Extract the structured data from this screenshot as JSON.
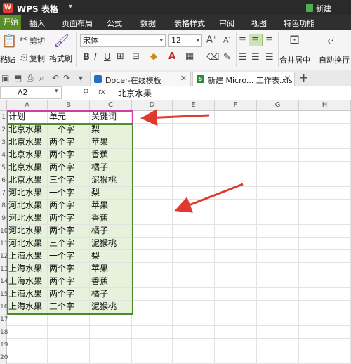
{
  "app": {
    "logo": "W",
    "title": "WPS 表格",
    "doc_title": "新建"
  },
  "menu": [
    "开始",
    "插入",
    "页面布局",
    "公式",
    "数据",
    "表格样式",
    "审阅",
    "视图",
    "特色功能"
  ],
  "ribbon": {
    "paste": "粘贴",
    "cut": "剪切",
    "copy": "复制",
    "format_painter": "格式刷",
    "font_name": "宋体",
    "font_size": "12",
    "merge_center": "合并居中",
    "auto_wrap": "自动换行"
  },
  "tabs": [
    {
      "label": "Docer-在线模板"
    },
    {
      "label": "新建 Micro... 工作表.xls"
    }
  ],
  "formula_bar": {
    "cell_ref": "A2",
    "fx": "fx",
    "value": "北京水果"
  },
  "columns": [
    "A",
    "B",
    "C",
    "D",
    "E",
    "F",
    "G",
    "H"
  ],
  "rows": [
    "1",
    "2",
    "3",
    "4",
    "5",
    "6",
    "7",
    "8",
    "9",
    "10",
    "11",
    "12",
    "13",
    "14",
    "15",
    "16",
    "17",
    "18",
    "19",
    "20"
  ],
  "table": {
    "headers": [
      "计划",
      "单元",
      "关键词"
    ],
    "rows": [
      [
        "北京水果",
        "一个字",
        "梨"
      ],
      [
        "北京水果",
        "两个字",
        "苹果"
      ],
      [
        "北京水果",
        "两个字",
        "香蕉"
      ],
      [
        "北京水果",
        "两个字",
        "橘子"
      ],
      [
        "北京水果",
        "三个字",
        "泥猴桃"
      ],
      [
        "河北水果",
        "一个字",
        "梨"
      ],
      [
        "河北水果",
        "两个字",
        "苹果"
      ],
      [
        "河北水果",
        "两个字",
        "香蕉"
      ],
      [
        "河北水果",
        "两个字",
        "橘子"
      ],
      [
        "河北水果",
        "三个字",
        "泥猴桃"
      ],
      [
        "上海水果",
        "一个字",
        "梨"
      ],
      [
        "上海水果",
        "两个字",
        "苹果"
      ],
      [
        "上海水果",
        "两个字",
        "香蕉"
      ],
      [
        "上海水果",
        "两个字",
        "橘子"
      ],
      [
        "上海水果",
        "三个字",
        "泥猴桃"
      ]
    ]
  },
  "colors": {
    "selection_border": "#4e8a2a",
    "selection_fill": "#e6f2dc",
    "highlight_box": "#d43aa9",
    "arrow": "#e03a2e",
    "menu_active": "#5b8c2a"
  }
}
